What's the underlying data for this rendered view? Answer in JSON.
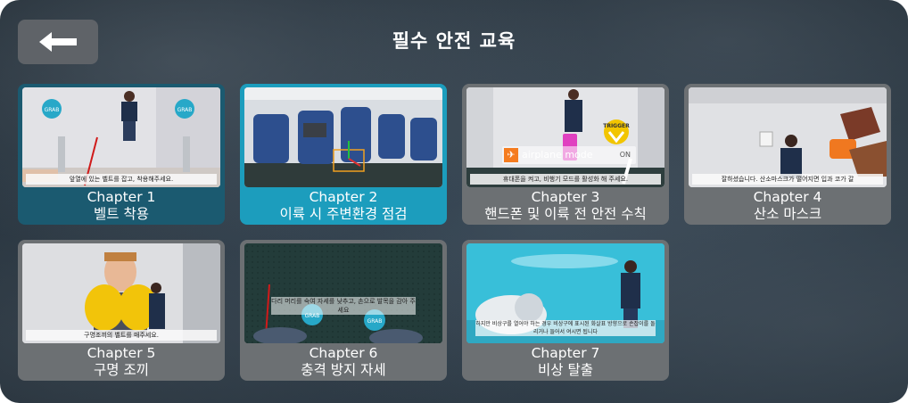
{
  "header": {
    "title": "필수 안전 교육",
    "back_icon": "arrow-left-icon"
  },
  "chapters": [
    {
      "number": "Chapter 1",
      "name": "벨트 착용",
      "subtitle": "앞열에 있는 벨트를 잡고, 착용해주세요.",
      "state": "active"
    },
    {
      "number": "Chapter 2",
      "name": "이륙 시 주변환경 점검",
      "subtitle": "",
      "state": "selected"
    },
    {
      "number": "Chapter 3",
      "name": "핸드폰 및 이륙 전 안전 수칙",
      "subtitle": "휴대폰을 켜고, 비행기 모드를 활성화 해 주세요.",
      "state": "normal",
      "overlay": {
        "airplane_label": "airplane mode",
        "toggle_label": "ON",
        "trigger_label": "TRIGGER"
      }
    },
    {
      "number": "Chapter 4",
      "name": "산소 마스크",
      "subtitle": "잘하셨습니다. 산소마스크가 떨어지면 입과 코가 갈",
      "state": "normal"
    },
    {
      "number": "Chapter 5",
      "name": "구명 조끼",
      "subtitle": "구명조끼의 벨트를 매주세요.",
      "state": "normal"
    },
    {
      "number": "Chapter 6",
      "name": "충격 방지 자세",
      "subtitle": "다리 머리를 숙여 자세를 낮추고, 손으로 발목을 감아 주세요",
      "state": "normal"
    },
    {
      "number": "Chapter 7",
      "name": "비상 탈출",
      "subtitle": "하지만 비상구를 열어야 하는 경우 비상구에 표시된 화살표 방향으로 손잡이를 돌리거나 들어서 여시면 됩니다",
      "state": "normal"
    }
  ],
  "badges": {
    "grab": "GRAB"
  },
  "colors": {
    "active_card": "#1b5a70",
    "selected_card": "#1c9dbd",
    "normal_card": "#6c7073",
    "background": "#2c3a46"
  }
}
